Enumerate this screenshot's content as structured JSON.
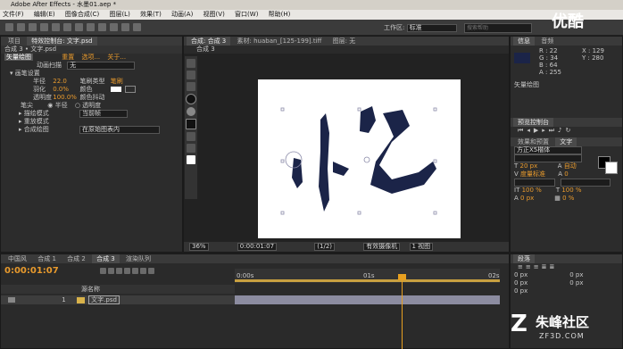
{
  "window": {
    "title": "Adobe After Effects - 水墨01.aep *"
  },
  "menu": [
    "文件(F)",
    "编辑(E)",
    "图像合成(C)",
    "图层(L)",
    "效果(T)",
    "动画(A)",
    "视图(V)",
    "窗口(W)",
    "帮助(H)"
  ],
  "toolbar": {
    "workspace_label": "工作区:",
    "workspace_value": "标准",
    "search_placeholder": "搜索帮助"
  },
  "left_panel": {
    "tabs": [
      "项目",
      "特效控制台: 文字.psd"
    ],
    "header": "合成 3 • 文字.psd",
    "effect_name": "矢量绘图",
    "links": [
      "重置",
      "选项...",
      "关于..."
    ],
    "anim_label": "动画扫描",
    "anim_value": "无",
    "section_brush": "画笔设置",
    "params": [
      {
        "label": "半径",
        "value": "22.0",
        "label2": "笔刷类型",
        "value2": "笔刷"
      },
      {
        "label": "羽化",
        "value": "0.0%",
        "label2": "颜色",
        "value2": ""
      },
      {
        "label": "透明度",
        "value": "100.0%",
        "label2": "颜色抖动",
        "value2": ""
      }
    ],
    "tip_label": "笔尖",
    "tip_options": [
      "半径",
      "透明度"
    ],
    "blend_label": "描绘模式",
    "blend_value": "当前帧",
    "playback_label": "重放模式",
    "playback_value": "",
    "comp_label": "合成绘图",
    "comp_value": "在原始图表内",
    "accent_color": "#e89a2d",
    "swatch_color": "#ffffff"
  },
  "viewer": {
    "tabs": [
      "合成: 合成 3",
      "素材: huaban_[125-199].tiff",
      "图层: 无"
    ],
    "subtab": "合成 3",
    "zoom": "36%",
    "timecode": "0:00:01:07",
    "resolution": "(1/2)",
    "camera": "有效摄像机",
    "views": "1 视图",
    "canvas_color": "#ffffff",
    "ink_color": "#1b2448"
  },
  "info_panel": {
    "tabs": [
      "信息",
      "音频"
    ],
    "r": "R : 22",
    "g": "G : 34",
    "b": "B : 64",
    "a": "A : 255",
    "x": "X : 129",
    "y": "Y : 280",
    "effect": "矢量绘图",
    "swatch": "#1b2448"
  },
  "preview_panel": {
    "title": "预览控制台"
  },
  "char_panel": {
    "tabs": [
      "效果和预置",
      "文字"
    ],
    "font": "方正X5楷体",
    "size": "20 px",
    "auto": "自动",
    "kerning": "度量标准",
    "tracking": "0",
    "scale_v": "100 %",
    "scale_h": "100 %",
    "baseline": "0 px",
    "tsume": "0 %"
  },
  "paragraph_panel": {
    "title": "段落",
    "values": [
      "0 px",
      "0 px",
      "0 px",
      "0 px",
      "0 px"
    ]
  },
  "timeline": {
    "tabs": [
      "中国风",
      "合成 1",
      "合成 2",
      "合成 3",
      "渲染队列"
    ],
    "timecode": "0:00:01:07",
    "ruler": [
      "0:00s",
      "01s",
      "02s"
    ],
    "layer_header": "源名称",
    "layer_number": "1",
    "layer_name": "文字.psd",
    "playhead_color": "#e8a020"
  },
  "watermark": {
    "text": "优酷",
    "site_cn": "朱峰社区",
    "site_en": "ZF3D.COM"
  }
}
